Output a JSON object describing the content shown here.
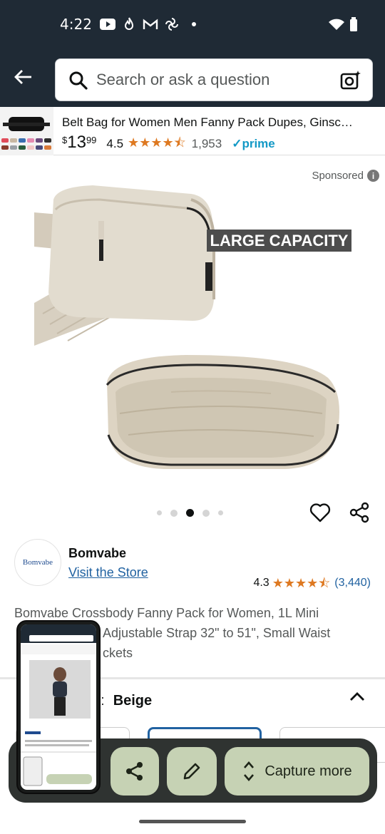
{
  "status_bar": {
    "time": "4:22"
  },
  "search": {
    "placeholder": "Search or ask a question"
  },
  "product_bar": {
    "title": "Belt Bag for Women Men Fanny Pack Dupes, Ginsc…",
    "price_symbol": "$",
    "price_whole": "13",
    "price_fraction": "99",
    "rating": "4.5",
    "rating_count": "1,953",
    "prime": "prime"
  },
  "sponsored": {
    "label": "Sponsored"
  },
  "hero": {
    "overlay_text": "LARGE CAPACITY"
  },
  "carousel": {
    "total": 5,
    "active": 3
  },
  "brand": {
    "logo_text": "Bomvabe",
    "name": "Bomvabe",
    "visit_link": "Visit the Store",
    "rating": "4.3",
    "rating_count": "(3,440)"
  },
  "description": {
    "line1": "Bomvabe Crossbody Fanny Pack for Women, 1L Mini",
    "line2": "Adjustable Strap 32\" to 51\", Small Waist",
    "line3": "ckets"
  },
  "color_selector": {
    "label_suffix": "e:",
    "value": "Beige"
  },
  "capture_bar": {
    "capture_more_label": "Capture more"
  },
  "colors": {
    "header_bg": "#1f2a35",
    "star": "#de7921",
    "link": "#2162a1",
    "prime": "#1399c6",
    "capture_button": "#c6d2b4"
  }
}
